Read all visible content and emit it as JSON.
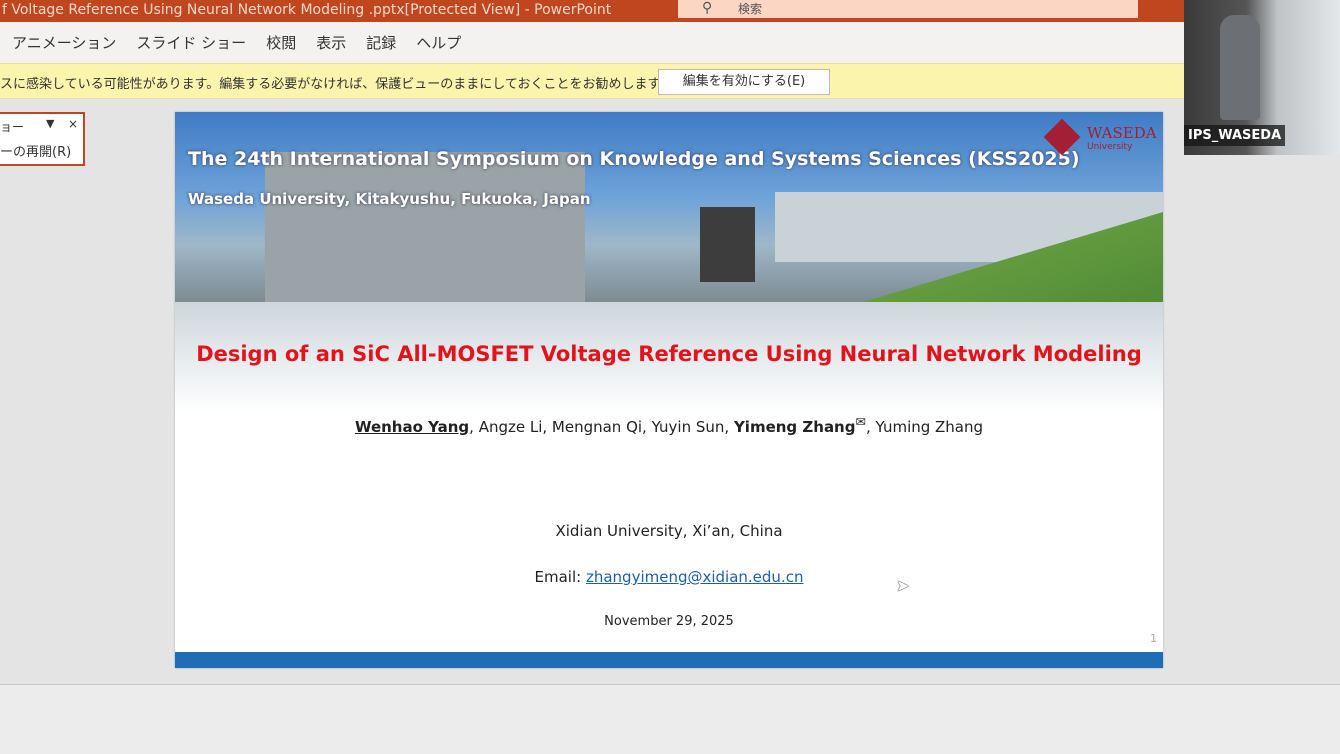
{
  "window": {
    "title": "f Voltage Reference Using Neural Network Modeling .pptx[Protected View]  -  PowerPoint",
    "search_placeholder": "検索"
  },
  "ribbon": {
    "tabs": [
      "アニメーション",
      "スライド ショー",
      "校閲",
      "表示",
      "記録",
      "ヘルプ"
    ]
  },
  "protected_view": {
    "message": "スに感染している可能性があります。編集する必要がなければ、保護ビューのままにしておくことをお勧めします。",
    "enable_button": "編集を有効にする(E)"
  },
  "side_pane": {
    "title": "ョー",
    "resume": "ーの再開(R)"
  },
  "slide": {
    "conference": "The 24th International Symposium on Knowledge and Systems Sciences (KSS2025)",
    "location": "Waseda University, Kitakyushu, Fukuoka, Japan",
    "logo_name": "WASEDA",
    "logo_sub": "University",
    "title": "Design of an SiC All-MOSFET Voltage Reference Using Neural Network Modeling",
    "author_1": "Wenhao Yang",
    "authors_mid": ", Angze Li, Mengnan Qi, Yuyin Sun, ",
    "author_corr": "Yimeng Zhang",
    "mail_mark": "✉",
    "authors_end": ", Yuming Zhang",
    "affiliation": "Xidian University, Xi’an, China",
    "email_label": "Email: ",
    "email": "zhangyimeng@xidian.edu.cn",
    "date": "November 29, 2025",
    "page_number": "1"
  },
  "video": {
    "participant": "IPS_WASEDA"
  },
  "colors": {
    "accent": "#c0461f",
    "title_red": "#e3131b",
    "bar_blue": "#1f6db4"
  }
}
